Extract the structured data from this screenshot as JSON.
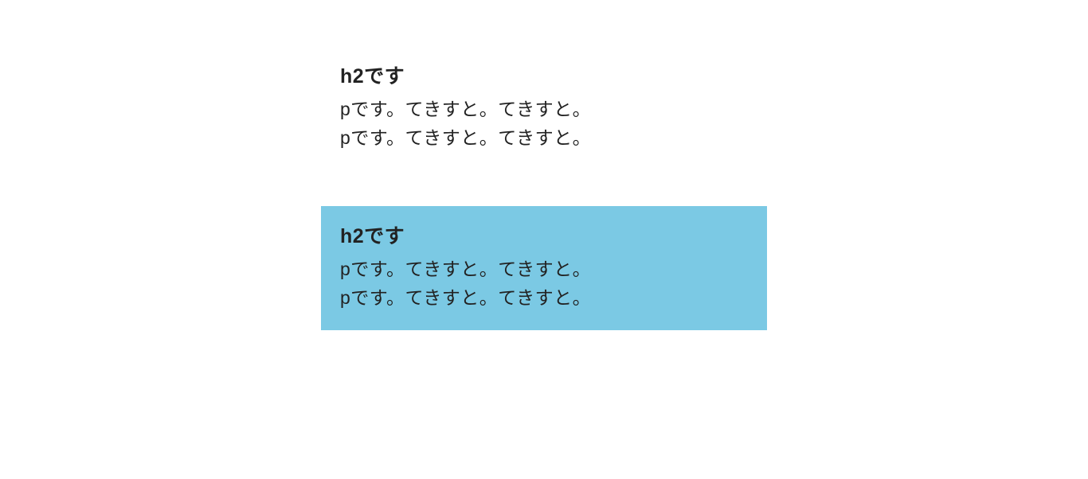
{
  "sections": [
    {
      "heading": "h2です",
      "line1": "pです。てきすと。てきすと。",
      "line2": "pです。てきすと。てきすと。",
      "highlight_color": null
    },
    {
      "heading": "h2です",
      "line1": "pです。てきすと。てきすと。",
      "line2": "pです。てきすと。てきすと。",
      "highlight_color": "#7bc9e4"
    }
  ]
}
